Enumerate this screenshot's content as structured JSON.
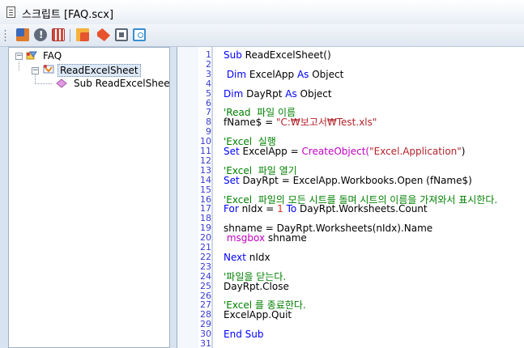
{
  "window": {
    "title": "스크립트 [FAQ.scx]",
    "icon": "document-icon"
  },
  "toolbar": {
    "icons": [
      "debug-icon",
      "info-icon",
      "calendar-icon",
      "run-script-icon",
      "tag-icon",
      "window-icon",
      "find-icon"
    ]
  },
  "tree": {
    "root": {
      "label": "FAQ",
      "expander": "−"
    },
    "module": {
      "label": "ReadExcelSheet",
      "expander": "−"
    },
    "procedure": {
      "label": "Sub  ReadExcelSheet"
    }
  },
  "editor": {
    "lines": [
      {
        "n": "1",
        "segs": [
          {
            "t": "Sub ",
            "c": "kw"
          },
          {
            "t": "ReadExcelSheet()",
            "c": ""
          }
        ]
      },
      {
        "n": "2",
        "segs": []
      },
      {
        "n": "3",
        "segs": [
          {
            "t": " Dim ",
            "c": "kw"
          },
          {
            "t": "ExcelApp ",
            "c": ""
          },
          {
            "t": "As ",
            "c": "kw"
          },
          {
            "t": "Object",
            "c": ""
          }
        ]
      },
      {
        "n": "4",
        "segs": []
      },
      {
        "n": "5",
        "segs": [
          {
            "t": "Dim ",
            "c": "kw"
          },
          {
            "t": "DayRpt ",
            "c": ""
          },
          {
            "t": "As ",
            "c": "kw"
          },
          {
            "t": "Object",
            "c": ""
          }
        ]
      },
      {
        "n": "6",
        "segs": []
      },
      {
        "n": "7",
        "segs": [
          {
            "t": "'Read  파일 이름",
            "c": "cm"
          }
        ]
      },
      {
        "n": "8",
        "segs": [
          {
            "t": "fName$ = ",
            "c": ""
          },
          {
            "t": "\"C:₩보고서₩Test.xls\"",
            "c": "st"
          }
        ]
      },
      {
        "n": "9",
        "segs": []
      },
      {
        "n": "10",
        "segs": [
          {
            "t": "'Excel  실행",
            "c": "cm"
          }
        ]
      },
      {
        "n": "11",
        "segs": [
          {
            "t": "Set ",
            "c": "kw"
          },
          {
            "t": "ExcelApp = ",
            "c": ""
          },
          {
            "t": "CreateObject(",
            "c": "fn"
          },
          {
            "t": "\"Excel.Application\"",
            "c": "st"
          },
          {
            "t": ")",
            "c": ""
          }
        ]
      },
      {
        "n": "12",
        "segs": []
      },
      {
        "n": "13",
        "segs": [
          {
            "t": "'Excel  파일 열기",
            "c": "cm"
          }
        ]
      },
      {
        "n": "14",
        "segs": [
          {
            "t": "Set ",
            "c": "kw"
          },
          {
            "t": "DayRpt = ExcelApp.Workbooks.Open (fName$)",
            "c": ""
          }
        ]
      },
      {
        "n": "15",
        "segs": []
      },
      {
        "n": "16",
        "segs": [
          {
            "t": "'Excel  파일의 모든 시트를 돌며 시트의 이름을 가져와서 표시한다.",
            "c": "cm"
          }
        ]
      },
      {
        "n": "17",
        "segs": [
          {
            "t": "For ",
            "c": "kw"
          },
          {
            "t": "nIdx = ",
            "c": ""
          },
          {
            "t": "1 ",
            "c": "num"
          },
          {
            "t": "To ",
            "c": "kw"
          },
          {
            "t": "DayRpt.Worksheets.Count",
            "c": ""
          }
        ]
      },
      {
        "n": "18",
        "segs": []
      },
      {
        "n": "19",
        "segs": [
          {
            "t": "shname = DayRpt.Worksheets(nIdx).Name",
            "c": ""
          }
        ]
      },
      {
        "n": "20",
        "segs": [
          {
            "t": " msgbox ",
            "c": "fn"
          },
          {
            "t": "shname",
            "c": ""
          }
        ]
      },
      {
        "n": "21",
        "segs": []
      },
      {
        "n": "22",
        "segs": [
          {
            "t": "Next ",
            "c": "kw"
          },
          {
            "t": "nIdx",
            "c": ""
          }
        ]
      },
      {
        "n": "23",
        "segs": []
      },
      {
        "n": "24",
        "segs": [
          {
            "t": "'파일을 닫는다.",
            "c": "cm"
          }
        ]
      },
      {
        "n": "25",
        "segs": [
          {
            "t": "DayRpt.Close",
            "c": ""
          }
        ]
      },
      {
        "n": "26",
        "segs": []
      },
      {
        "n": "27",
        "segs": [
          {
            "t": "'Excel 를 종료한다.",
            "c": "cm"
          }
        ]
      },
      {
        "n": "28",
        "segs": [
          {
            "t": "ExcelApp.Quit",
            "c": ""
          }
        ]
      },
      {
        "n": "29",
        "segs": []
      },
      {
        "n": "30",
        "segs": [
          {
            "t": "End Sub",
            "c": "kw"
          }
        ]
      },
      {
        "n": "31",
        "segs": []
      }
    ]
  }
}
